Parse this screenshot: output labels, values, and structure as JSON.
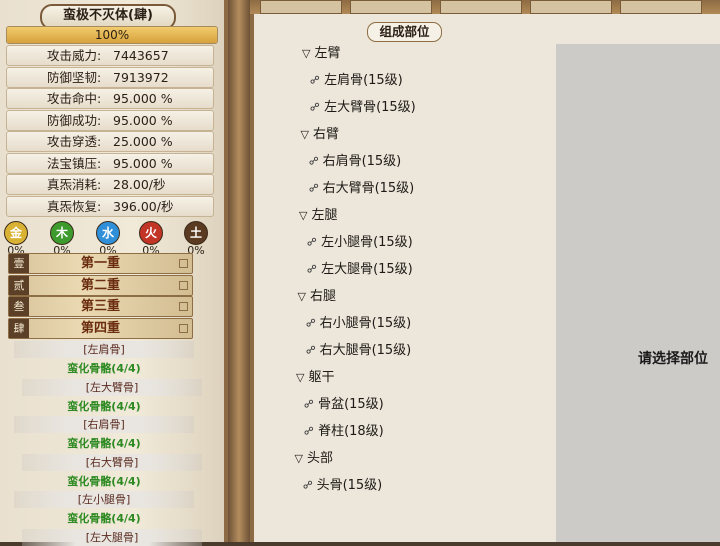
{
  "left": {
    "title": "蛮极不灭体(肆)",
    "progress": {
      "text": "100%",
      "value": 100
    },
    "stats": [
      {
        "label": "攻击威力:",
        "value": "7443657"
      },
      {
        "label": "防御坚韧:",
        "value": "7913972"
      },
      {
        "label": "攻击命中:",
        "value": "95.000 %"
      },
      {
        "label": "防御成功:",
        "value": "95.000 %"
      },
      {
        "label": "攻击穿透:",
        "value": "25.000 %"
      },
      {
        "label": "法宝镇压:",
        "value": "95.000 %"
      },
      {
        "label": "真炁消耗:",
        "value": "28.00/秒"
      },
      {
        "label": "真炁恢复:",
        "value": "396.00/秒"
      }
    ],
    "elements": [
      {
        "glyph": "金",
        "pct": "0%",
        "color": "#d9b234"
      },
      {
        "glyph": "木",
        "pct": "0%",
        "color": "#3c9b2c"
      },
      {
        "glyph": "水",
        "pct": "0%",
        "color": "#2f8fd8"
      },
      {
        "glyph": "火",
        "pct": "0%",
        "color": "#c23425"
      },
      {
        "glyph": "土",
        "pct": "0%",
        "color": "#5b3a22"
      }
    ],
    "layers": [
      {
        "num": "壹",
        "name": "第一重"
      },
      {
        "num": "贰",
        "name": "第二重"
      },
      {
        "num": "叁",
        "name": "第三重"
      },
      {
        "num": "肆",
        "name": "第四重"
      }
    ],
    "parts": [
      {
        "tag": "[左肩骨]",
        "status": "蛮化骨骼(4/4)"
      },
      {
        "tag": "[左大臂骨]",
        "status": "蛮化骨骼(4/4)"
      },
      {
        "tag": "[右肩骨]",
        "status": "蛮化骨骼(4/4)"
      },
      {
        "tag": "[右大臂骨]",
        "status": "蛮化骨骼(4/4)"
      },
      {
        "tag": "[左小腿骨]",
        "status": "蛮化骨骼(4/4)"
      },
      {
        "tag": "[左大腿骨]"
      }
    ]
  },
  "right": {
    "title": "组成部位",
    "groups": [
      {
        "name": "左臂",
        "items": [
          "左肩骨(15级)",
          "左大臂骨(15级)"
        ]
      },
      {
        "name": "右臂",
        "items": [
          "右肩骨(15级)",
          "右大臂骨(15级)"
        ]
      },
      {
        "name": "左腿",
        "items": [
          "左小腿骨(15级)",
          "左大腿骨(15级)"
        ]
      },
      {
        "name": "右腿",
        "items": [
          "右小腿骨(15级)",
          "右大腿骨(15级)"
        ]
      },
      {
        "name": "躯干",
        "items": [
          "骨盆(15级)",
          "脊柱(18级)"
        ]
      },
      {
        "name": "头部",
        "items": [
          "头骨(15级)"
        ]
      }
    ],
    "detail_hint": "请选择部位"
  },
  "icons": {
    "expand": "triangle-down-icon",
    "bone": "bone-icon",
    "element_orb": "element-orb-icon"
  }
}
